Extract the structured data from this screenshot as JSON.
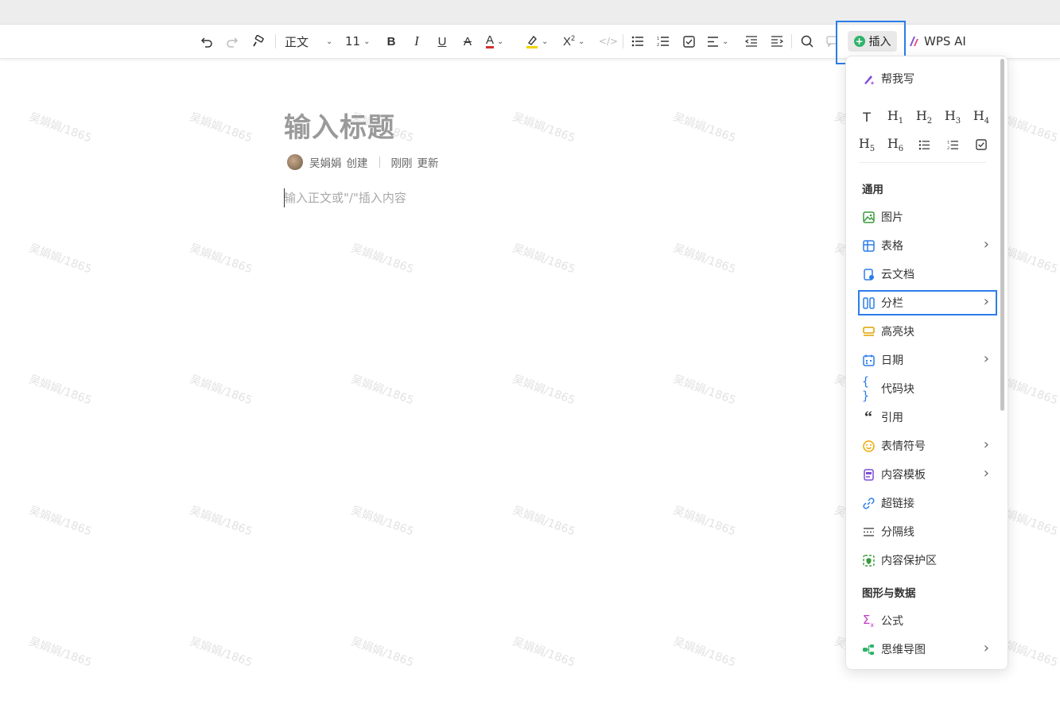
{
  "toolbar": {
    "style_label": "正文",
    "font_size": "11",
    "insert_label": "插入",
    "ai_label": "WPS AI"
  },
  "watermark": "吴娟娟/1865",
  "document": {
    "title_placeholder": "输入标题",
    "author": "吴娟娟",
    "created_label": "创建",
    "updated_time": "刚刚",
    "updated_label": "更新",
    "body_placeholder": "输入正文或\"/\"插入内容"
  },
  "insert_menu": {
    "ai_write": "帮我写",
    "headings": [
      "T",
      "H1",
      "H2",
      "H3",
      "H4",
      "H5",
      "H6"
    ],
    "section_general": "通用",
    "general_items": [
      {
        "label": "图片",
        "icon": "image-icon",
        "has_submenu": false,
        "color": "#3a9a3a"
      },
      {
        "label": "表格",
        "icon": "table-icon",
        "has_submenu": true,
        "color": "#2b7de9"
      },
      {
        "label": "云文档",
        "icon": "cloud-doc-icon",
        "has_submenu": false,
        "color": "#2b7de9"
      },
      {
        "label": "分栏",
        "icon": "columns-icon",
        "has_submenu": true,
        "color": "#2b7de9"
      },
      {
        "label": "高亮块",
        "icon": "highlight-block-icon",
        "has_submenu": false,
        "color": "#e0a000"
      },
      {
        "label": "日期",
        "icon": "calendar-icon",
        "has_submenu": true,
        "color": "#2b7de9"
      },
      {
        "label": "代码块",
        "icon": "code-block-icon",
        "has_submenu": false,
        "color": "#2b7de9"
      },
      {
        "label": "引用",
        "icon": "quote-icon",
        "has_submenu": false,
        "color": "#333333"
      },
      {
        "label": "表情符号",
        "icon": "emoji-icon",
        "has_submenu": true,
        "color": "#f0a800"
      },
      {
        "label": "内容模板",
        "icon": "template-icon",
        "has_submenu": true,
        "color": "#7b4fd6"
      },
      {
        "label": "超链接",
        "icon": "link-icon",
        "has_submenu": false,
        "color": "#2b7de9"
      },
      {
        "label": "分隔线",
        "icon": "divider-icon",
        "has_submenu": false,
        "color": "#555555"
      },
      {
        "label": "内容保护区",
        "icon": "protect-icon",
        "has_submenu": false,
        "color": "#3a9a3a"
      }
    ],
    "section_graphics": "图形与数据",
    "graphics_items": [
      {
        "label": "公式",
        "icon": "formula-icon",
        "has_submenu": false,
        "color": "#c23ac2"
      },
      {
        "label": "思维导图",
        "icon": "mindmap-icon",
        "has_submenu": true,
        "color": "#2fb36a"
      }
    ]
  }
}
